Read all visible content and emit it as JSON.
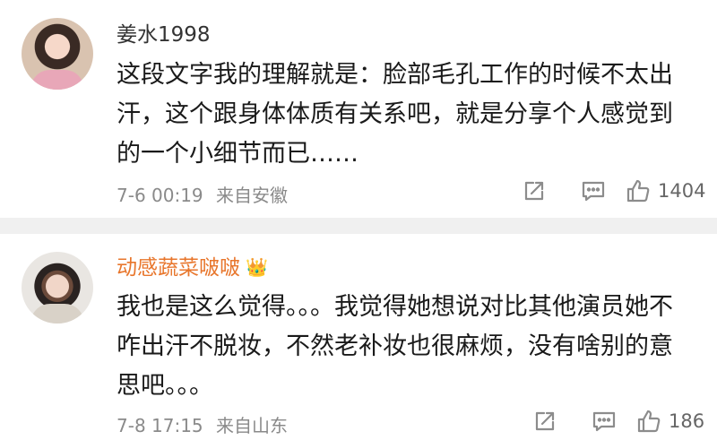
{
  "comments": [
    {
      "username": "姜水1998",
      "text": "这段文字我的理解就是：脸部毛孔工作的时候不太出汗，这个跟身体体质有关系吧，就是分享个人感觉到的一个小细节而已……",
      "date": "7-6 00:19",
      "location": "来自安徽",
      "likes": "1404",
      "avatar_icon": "user-avatar",
      "badge": ""
    },
    {
      "username": "动感蔬菜啵啵",
      "text": "我也是这么觉得。。。我觉得她想说对比其他演员她不咋出汗不脱妆，不然老补妆也很麻烦，没有啥别的意思吧。。。",
      "date": "7-8 17:15",
      "location": "来自山东",
      "likes": "186",
      "avatar_icon": "user-avatar",
      "badge": "crown"
    }
  ],
  "colors": {
    "username_default": "#333333",
    "username_vip": "#e8762c",
    "meta": "#8a8a8a",
    "divider": "#f0f0f0"
  }
}
